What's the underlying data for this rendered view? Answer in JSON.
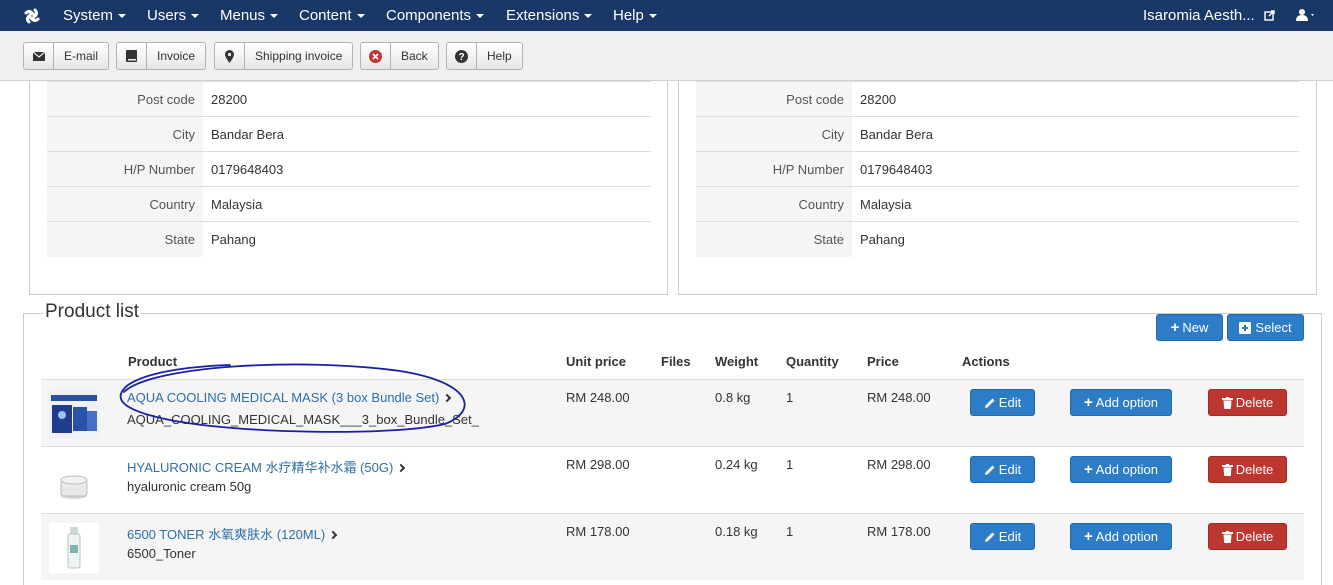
{
  "nav": {
    "items": [
      "System",
      "Users",
      "Menus",
      "Content",
      "Components",
      "Extensions",
      "Help"
    ],
    "site_name": "Isaromia Aesth..."
  },
  "toolbar": {
    "email": "E-mail",
    "invoice": "Invoice",
    "shipping": "Shipping invoice",
    "back": "Back",
    "help": "Help"
  },
  "billing": {
    "rows": [
      {
        "k": "Post code",
        "v": "28200"
      },
      {
        "k": "City",
        "v": "Bandar Bera"
      },
      {
        "k": "H/P Number",
        "v": "0179648403"
      },
      {
        "k": "Country",
        "v": "Malaysia"
      },
      {
        "k": "State",
        "v": "Pahang"
      }
    ]
  },
  "shipping": {
    "rows": [
      {
        "k": "Post code",
        "v": "28200"
      },
      {
        "k": "City",
        "v": "Bandar Bera"
      },
      {
        "k": "H/P Number",
        "v": "0179648403"
      },
      {
        "k": "Country",
        "v": "Malaysia"
      },
      {
        "k": "State",
        "v": "Pahang"
      }
    ]
  },
  "products": {
    "title": "Product list",
    "new_label": "New",
    "select_label": "Select",
    "headers": {
      "product": "Product",
      "unit_price": "Unit price",
      "files": "Files",
      "weight": "Weight",
      "quantity": "Quantity",
      "price": "Price",
      "actions": "Actions"
    },
    "edit_label": "Edit",
    "add_option_label": "Add option",
    "delete_label": "Delete",
    "rows": [
      {
        "name": "AQUA COOLING MEDICAL MASK (3 box Bundle Set)",
        "sku": "AQUA_COOLING_MEDICAL_MASK___3_box_Bundle_Set_",
        "unit_price": "RM 248.00",
        "weight": "0.8 kg",
        "quantity": "1",
        "price": "RM 248.00"
      },
      {
        "name": "HYALURONIC CREAM 水疗精华补水霜 (50G)",
        "sku": "hyaluronic cream 50g",
        "unit_price": "RM 298.00",
        "weight": "0.24 kg",
        "quantity": "1",
        "price": "RM 298.00"
      },
      {
        "name": "6500 TONER 水氧爽肤水 (120ML)",
        "sku": "6500_Toner",
        "unit_price": "RM 178.00",
        "weight": "0.18 kg",
        "quantity": "1",
        "price": "RM 178.00"
      }
    ]
  },
  "colors": {
    "navbar": "#1a3867",
    "primary": "#2d7cc7",
    "danger": "#bd362f",
    "link": "#2f6ea7",
    "annotation": "#1a1fa8"
  }
}
